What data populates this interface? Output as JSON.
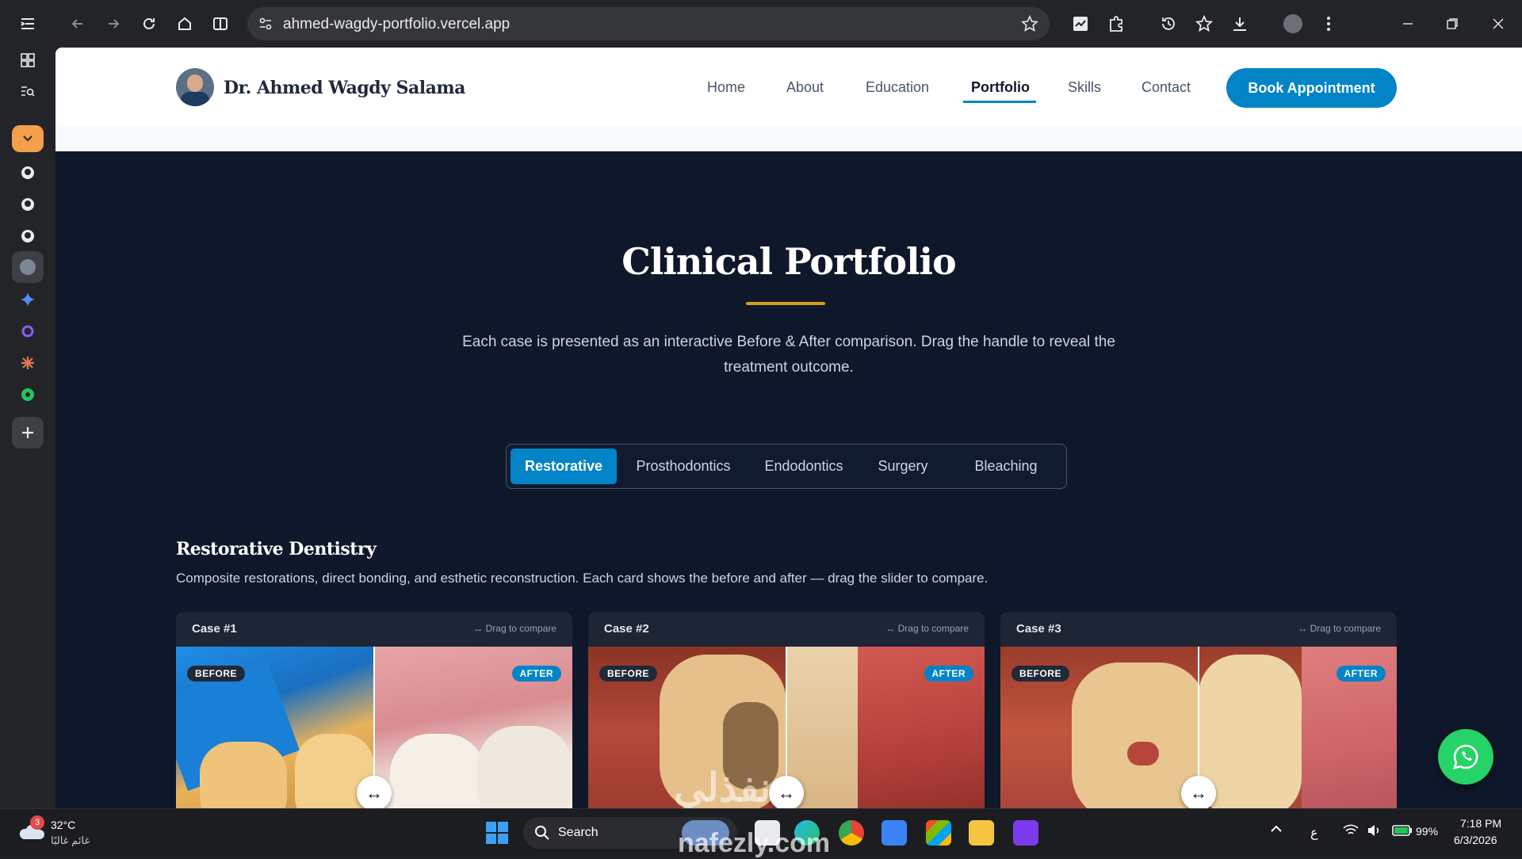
{
  "browser": {
    "url": "ahmed-wagdy-portfolio.vercel.app"
  },
  "nav": {
    "brand": "Dr. Ahmed Wagdy Salama",
    "links": [
      "Home",
      "About",
      "Education",
      "Portfolio",
      "Skills",
      "Contact"
    ],
    "active": "Portfolio",
    "cta": "Book Appointment"
  },
  "hero": {
    "title": "Clinical Portfolio",
    "description": "Each case is presented as an interactive Before & After comparison. Drag the handle to reveal the treatment outcome."
  },
  "tabs": {
    "items": [
      "Restorative",
      "Prosthodontics",
      "Endodontics",
      "Surgery",
      "Bleaching"
    ],
    "active": "Restorative"
  },
  "section": {
    "title": "Restorative Dentistry",
    "description": "Composite restorations, direct bonding, and esthetic reconstruction. Each card shows the before and after — drag the slider to compare."
  },
  "cases": [
    {
      "label": "Case #1",
      "hint": "↔ Drag to compare",
      "before": "BEFORE",
      "after": "AFTER",
      "slider": 0.5
    },
    {
      "label": "Case #2",
      "hint": "↔ Drag to compare",
      "before": "BEFORE",
      "after": "AFTER",
      "slider": 0.5
    },
    {
      "label": "Case #3",
      "hint": "↔ Drag to compare",
      "before": "BEFORE",
      "after": "AFTER",
      "slider": 0.5
    }
  ],
  "handle_glyph": "↔",
  "taskbar": {
    "weather_temp": "32°C",
    "weather_desc": "غائم غالبًا",
    "weather_badge": "3",
    "search_label": "Search",
    "language": "ع",
    "battery": "99%",
    "time": "7:18 PM",
    "date": "6/3/2026"
  },
  "watermark": "nafezly.com",
  "watermark_ar": "نفذلي",
  "colors": {
    "accent": "#0284c7",
    "gold": "#d4a017",
    "page_bg": "#0f172a",
    "whatsapp": "#25d366"
  }
}
